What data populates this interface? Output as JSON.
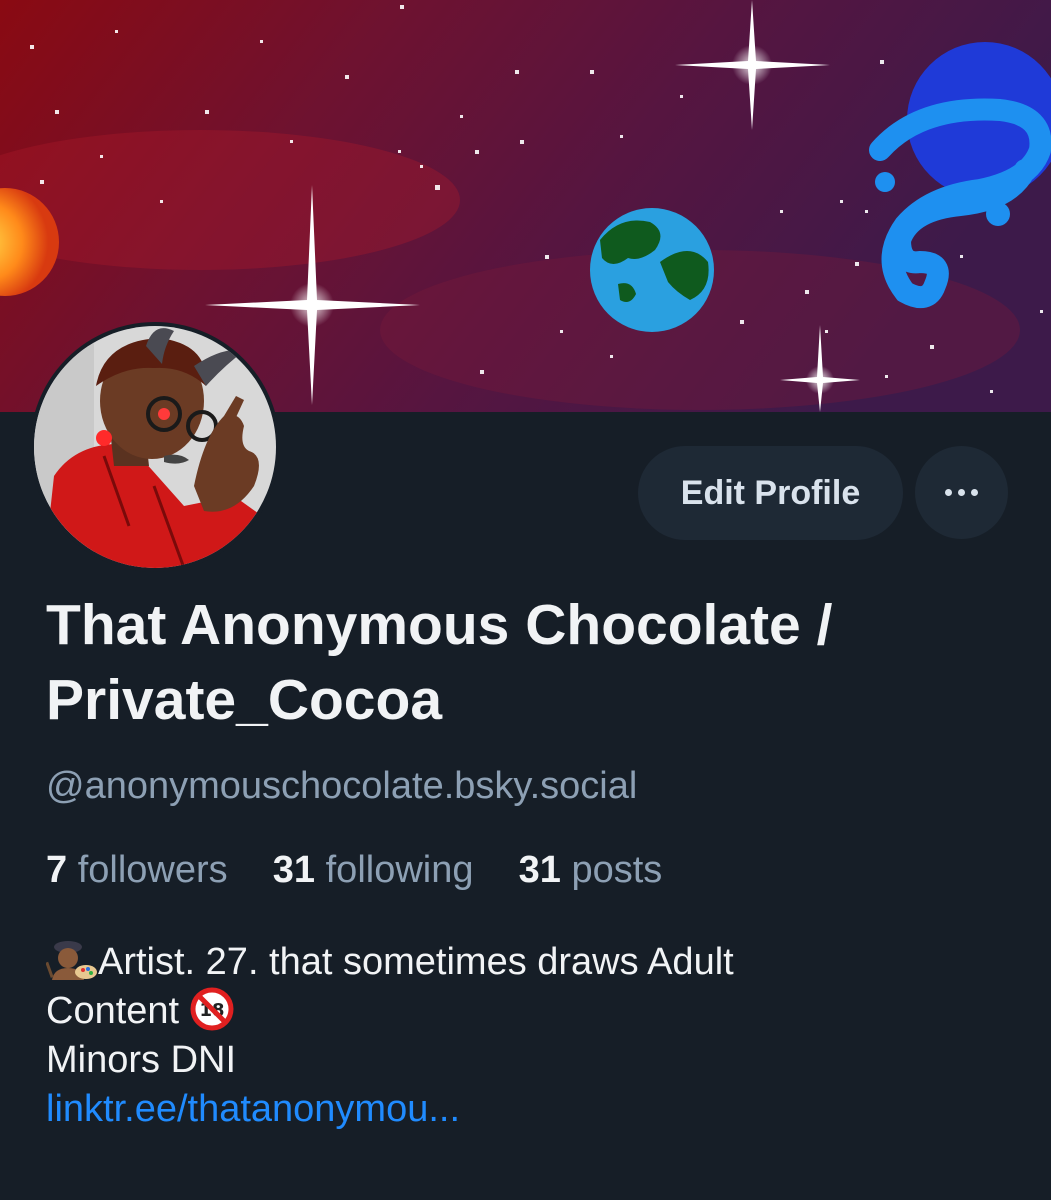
{
  "profile": {
    "display_name": "That Anonymous Chocolate / Private_Cocoa",
    "handle": "@anonymouschocolate.bsky.social",
    "stats": {
      "followers_count": "7",
      "followers_label": "followers",
      "following_count": "31",
      "following_label": "following",
      "posts_count": "31",
      "posts_label": "posts"
    },
    "bio": {
      "line1_emoji": "artist-emoji",
      "line1_text": "Artist. 27. that sometimes draws Adult",
      "line2_text": "Content",
      "line2_emoji": "no-under-18-emoji",
      "line3_text": "Minors DNI",
      "link_text": "linktr.ee/thatanonymou..."
    }
  },
  "actions": {
    "edit_profile_label": "Edit Profile",
    "more_icon": "ellipsis-icon"
  },
  "colors": {
    "background": "#161e27",
    "button_bg": "#1e2935",
    "text_primary": "#f1f3f5",
    "text_secondary": "#8da0b4",
    "link": "#208bfe"
  }
}
